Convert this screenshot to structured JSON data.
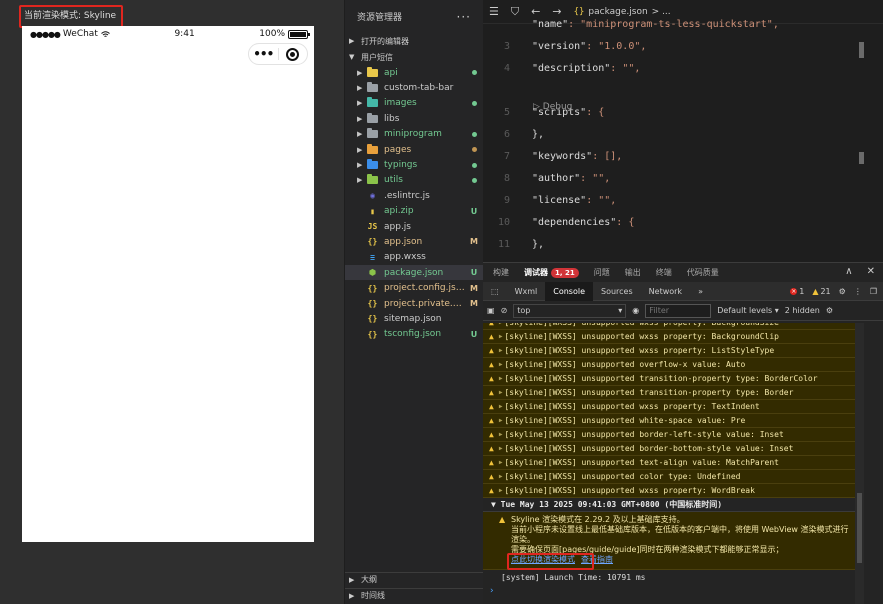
{
  "simulator": {
    "render_mode": "当前渲染模式: Skyline",
    "status_signal": "●●●●●",
    "carrier": "WeChat",
    "wifi_icon": "wifi-icon",
    "time": "9:41",
    "battery": "100%",
    "battery_level": 1.0,
    "capsule_more": "•••"
  },
  "explorer": {
    "title": "资源管理器",
    "more": "···",
    "open_editors": "打开的编辑器",
    "workspace": "用户短信",
    "items": [
      {
        "label": "api",
        "kind": "folder",
        "color": "#e8c74a",
        "status": "dot",
        "status_color": "#73c991",
        "label_color": "#73c991"
      },
      {
        "label": "custom-tab-bar",
        "kind": "folder",
        "color": "#9aa0a6",
        "status": "",
        "status_color": "",
        "label_color": "#cccccc"
      },
      {
        "label": "images",
        "kind": "folder",
        "color": "#44b8a8",
        "status": "dot",
        "status_color": "#73c991",
        "label_color": "#73c991"
      },
      {
        "label": "libs",
        "kind": "folder",
        "color": "#9aa0a6",
        "status": "",
        "status_color": "",
        "label_color": "#cccccc"
      },
      {
        "label": "miniprogram",
        "kind": "folder",
        "color": "#9aa0a6",
        "status": "dot",
        "status_color": "#73c991",
        "label_color": "#73c991"
      },
      {
        "label": "pages",
        "kind": "folder",
        "color": "#e8a03c",
        "status": "dot",
        "status_color": "#c09553",
        "label_color": "#e2c08d"
      },
      {
        "label": "typings",
        "kind": "folder",
        "color": "#3b8eea",
        "status": "dot",
        "status_color": "#73c991",
        "label_color": "#73c991"
      },
      {
        "label": "utils",
        "kind": "folder",
        "color": "#8bc34a",
        "status": "dot",
        "status_color": "#73c991",
        "label_color": "#73c991"
      },
      {
        "label": ".eslintrc.js",
        "kind": "file",
        "icon": "◉",
        "icon_color": "#6f6fdc",
        "status": "",
        "label_color": "#cccccc"
      },
      {
        "label": "api.zip",
        "kind": "file",
        "icon": "▮",
        "icon_color": "#e8c74a",
        "status": "U",
        "status_color": "#73c991",
        "label_color": "#73c991"
      },
      {
        "label": "app.js",
        "kind": "file",
        "icon": "JS",
        "icon_color": "#e8c74a",
        "status": "",
        "label_color": "#cccccc"
      },
      {
        "label": "app.json",
        "kind": "file",
        "icon": "{}",
        "icon_color": "#e8c74a",
        "status": "M",
        "status_color": "#e2c08d",
        "label_color": "#e2c08d"
      },
      {
        "label": "app.wxss",
        "kind": "file",
        "icon": "≡",
        "icon_color": "#42a5f5",
        "status": "",
        "label_color": "#cccccc"
      },
      {
        "label": "package.json",
        "kind": "file",
        "icon": "⬢",
        "icon_color": "#8bc34a",
        "status": "U",
        "status_color": "#73c991",
        "label_color": "#73c991",
        "active": true
      },
      {
        "label": "project.config.json",
        "kind": "file",
        "icon": "{}",
        "icon_color": "#e8c74a",
        "status": "M",
        "status_color": "#e2c08d",
        "label_color": "#e2c08d"
      },
      {
        "label": "project.private.co...",
        "kind": "file",
        "icon": "{}",
        "icon_color": "#e8c74a",
        "status": "M",
        "status_color": "#e2c08d",
        "label_color": "#e2c08d"
      },
      {
        "label": "sitemap.json",
        "kind": "file",
        "icon": "{}",
        "icon_color": "#e8c74a",
        "status": "",
        "label_color": "#cccccc"
      },
      {
        "label": "tsconfig.json",
        "kind": "file",
        "icon": "{}",
        "icon_color": "#e8c74a",
        "status": "U",
        "status_color": "#73c991",
        "label_color": "#73c991"
      }
    ],
    "footer_outline": "大纲",
    "footer_timeline": "时间线"
  },
  "editor": {
    "breadcrumb_file": "package.json",
    "breadcrumb_more": "> ...",
    "debug_lens": "▷ Debug",
    "lines": [
      {
        "n": "",
        "key": "\"name\"",
        "val": ": \"miniprogram-ts-less-quickstart\","
      },
      {
        "n": "3",
        "key": "\"version\"",
        "val": ": \"1.0.0\","
      },
      {
        "n": "4",
        "key": "\"description\"",
        "val": ": \"\","
      },
      {
        "n": "5",
        "key": "\"scripts\"",
        "val": ": {"
      },
      {
        "n": "6",
        "key": "},",
        "val": ""
      },
      {
        "n": "7",
        "key": "\"keywords\"",
        "val": ": [],"
      },
      {
        "n": "8",
        "key": "\"author\"",
        "val": ": \"\","
      },
      {
        "n": "9",
        "key": "\"license\"",
        "val": ": \"\","
      },
      {
        "n": "10",
        "key": "\"dependencies\"",
        "val": ": {"
      },
      {
        "n": "11",
        "key": "},",
        "val": ""
      }
    ]
  },
  "debugger": {
    "tabs": [
      "构建",
      "调试器",
      "问题",
      "输出",
      "终端",
      "代码质量"
    ],
    "active_tab": "调试器",
    "error_pill": "1, 21",
    "devtools_tabs": [
      "Wxml",
      "Console",
      "Sources",
      "Network",
      "»"
    ],
    "active_devtools_tab": "Console",
    "errors_count": "1",
    "warnings_count": "21",
    "context": "top",
    "filter_placeholder": "Filter",
    "levels": "Default levels ▾",
    "hidden": "2 hidden",
    "warnings": [
      "[skyline][WXSS] unsupported wxss property: BackgroundSize",
      "[skyline][WXSS] unsupported wxss property: BackgroundClip",
      "[skyline][WXSS] unsupported wxss property: ListStyleType",
      "[skyline][WXSS] unsupported overflow-x value: Auto",
      "[skyline][WXSS] unsupported transition-property type: BorderColor",
      "[skyline][WXSS] unsupported transition-property type: Border",
      "[skyline][WXSS] unsupported wxss property: TextIndent",
      "[skyline][WXSS] unsupported white-space value: Pre",
      "[skyline][WXSS] unsupported border-left-style value: Inset",
      "[skyline][WXSS] unsupported border-bottom-style value: Inset",
      "[skyline][WXSS] unsupported text-align value: MatchParent",
      "[skyline][WXSS] unsupported color type: Undefined",
      "[skyline][WXSS] unsupported wxss property: WordBreak"
    ],
    "group_header": "▼ Tue May 13 2025 09:41:03 GMT+0800 (中国标准时间)",
    "message_lines": [
      "Skyline 渲染模式在 2.29.2 及以上基础库支持。",
      "当前小程序未设置线上最低基础库版本，在低版本的客户端中，将使用 WebView 渲染模式进行渲染。",
      "需要确保页面[pages/guide/guide]同时在两种渲染模式下都能够正常显示；"
    ],
    "link_switch": "点此切换渲染模式",
    "link_more": "查看指南",
    "system_line": "[system] Launch Time: 10791 ms",
    "prompt": "›"
  }
}
